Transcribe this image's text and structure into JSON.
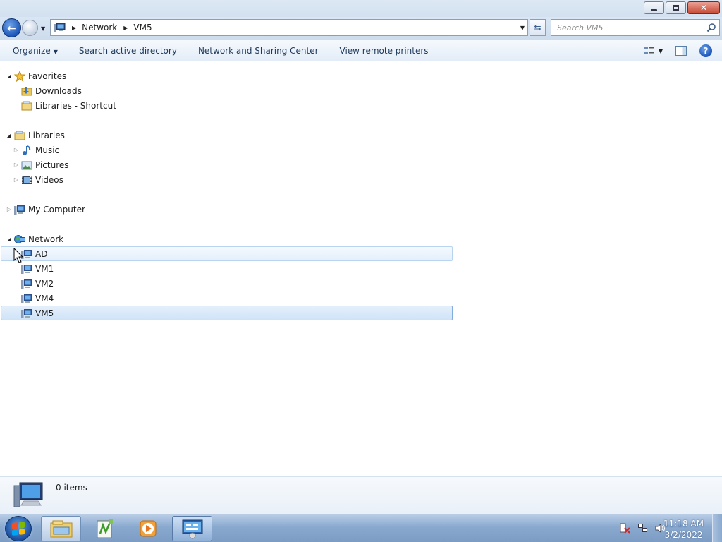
{
  "window": {
    "title_buttons": {
      "minimize": "minimize",
      "restore": "restore",
      "close": "close"
    }
  },
  "address": {
    "breadcrumbs": [
      "Network",
      "VM5"
    ],
    "search_placeholder": "Search VM5"
  },
  "commandbar": {
    "organize": "Organize",
    "search_ad": "Search active directory",
    "network_sharing": "Network and Sharing Center",
    "remote_printers": "View remote printers"
  },
  "nav": {
    "favorites": {
      "label": "Favorites",
      "items": [
        "Downloads",
        "Libraries - Shortcut"
      ]
    },
    "libraries": {
      "label": "Libraries",
      "items": [
        "Music",
        "Pictures",
        "Videos"
      ]
    },
    "computer": {
      "label": "My Computer"
    },
    "network": {
      "label": "Network",
      "items": [
        "AD",
        "VM1",
        "VM2",
        "VM4",
        "VM5"
      ],
      "selected": "VM5",
      "hovered": "AD"
    }
  },
  "details": {
    "count": "0 items"
  },
  "taskbar": {
    "apps": [
      "windows-explorer",
      "notepad-plus-plus",
      "media-player",
      "remote-desktop"
    ],
    "clock_time": "11:18 AM",
    "clock_date": "3/2/2022"
  },
  "colors": {
    "accent": "#1c55b8",
    "selection": "#cfe3f8",
    "taskbar": "#8aa9cf"
  }
}
